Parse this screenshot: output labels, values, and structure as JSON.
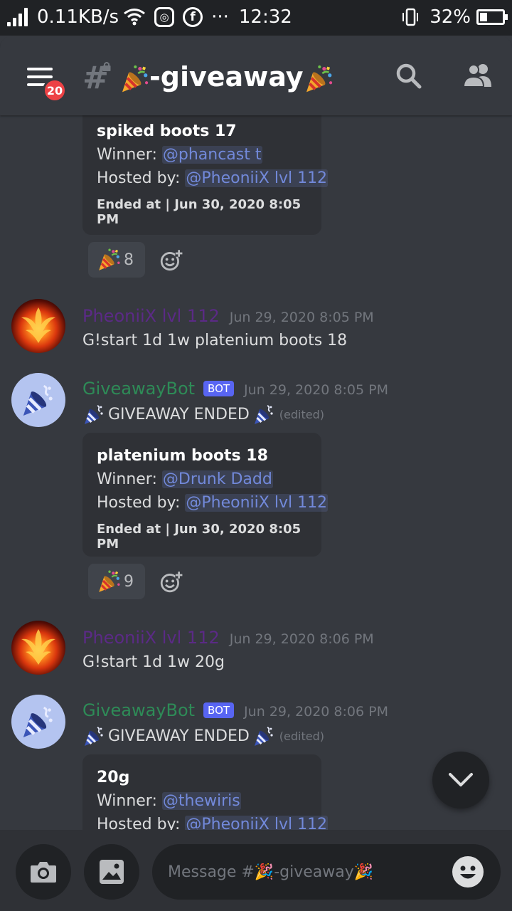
{
  "status_bar": {
    "net_speed": "0.11KB/s",
    "time": "12:32",
    "battery": "32%",
    "battery_level": 0.32
  },
  "header": {
    "channel_name": "-giveaway",
    "badge_count": "20"
  },
  "messages": {
    "embed1": {
      "title": "spiked boots 17",
      "winner_label": "Winner:",
      "winner": "@phancast t",
      "host_label": "Hosted by:",
      "host": "@PheoniiX lvl 112",
      "ended": "Ended at | Jun 30, 2020 8:05 PM",
      "reaction_count": "8"
    },
    "msg2": {
      "author": "PheoniiX lvl 112",
      "time": "Jun 29, 2020 8:05 PM",
      "text": "G!start 1d 1w platenium boots 18"
    },
    "msg3": {
      "author": "GiveawayBot",
      "bot_tag": "BOT",
      "time": "Jun 29, 2020 8:05 PM",
      "text": "GIVEAWAY ENDED",
      "edited": "(edited)",
      "embed": {
        "title": "platenium boots 18",
        "winner_label": "Winner:",
        "winner": "@Drunk Dadd",
        "host_label": "Hosted by:",
        "host": "@PheoniiX lvl 112",
        "ended": "Ended at | Jun 30, 2020 8:05 PM",
        "reaction_count": "9"
      }
    },
    "msg4": {
      "author": "PheoniiX lvl 112",
      "time": "Jun 29, 2020 8:06 PM",
      "text": "G!start 1d 1w 20g"
    },
    "msg5": {
      "author": "GiveawayBot",
      "bot_tag": "BOT",
      "time": "Jun 29, 2020 8:06 PM",
      "text": "GIVEAWAY ENDED",
      "edited": "(edited)",
      "embed": {
        "title": "20g",
        "winner_label": "Winner:",
        "winner": "@thewiris",
        "host_label": "Hosted by:",
        "host": "@PheoniiX lvl 112"
      }
    }
  },
  "input": {
    "placeholder": "Message #🎉-giveaway🎉"
  },
  "colors": {
    "background": "#36393f",
    "mention": "#7289da",
    "bot_badge": "#5865f2",
    "notification_badge": "#ed4245"
  }
}
